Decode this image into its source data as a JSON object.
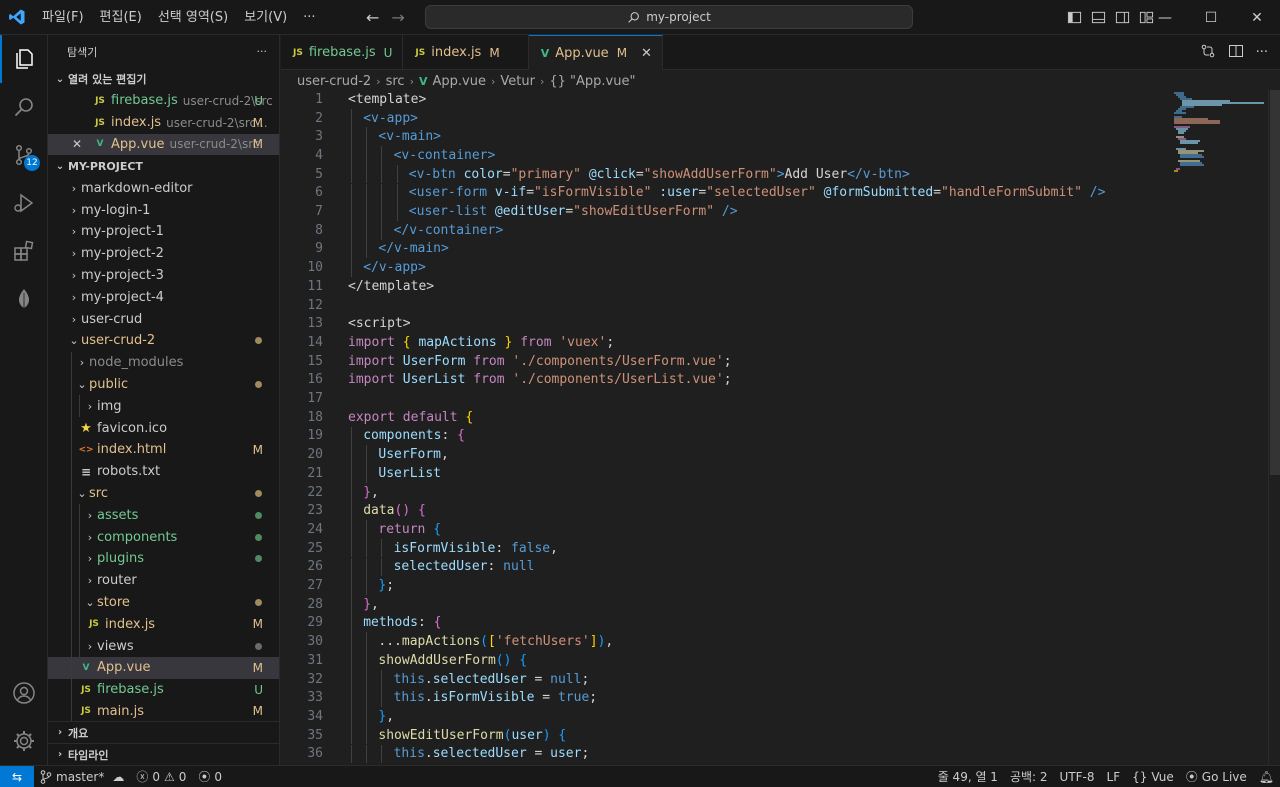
{
  "menu": [
    "파일(F)",
    "편집(E)",
    "선택 영역(S)",
    "보기(V)",
    "···"
  ],
  "search": {
    "text": "my-project"
  },
  "activity": {
    "scm_badge": "12"
  },
  "sidebar": {
    "title": "탐색기",
    "more": "···",
    "open_editors_title": "열려 있는 편집기",
    "open_editors": [
      {
        "icon": "JS",
        "name": "firebase.js",
        "path": "user-crud-2\\src",
        "badge": "U"
      },
      {
        "icon": "JS",
        "name": "index.js",
        "path": "user-crud-2\\src...",
        "badge": "M"
      },
      {
        "icon": "V",
        "name": "App.vue",
        "path": "user-crud-2\\src",
        "badge": "M"
      }
    ],
    "project_title": "MY-PROJECT",
    "tree": {
      "markdown_editor": "markdown-editor",
      "my_login_1": "my-login-1",
      "my_project_1": "my-project-1",
      "my_project_2": "my-project-2",
      "my_project_3": "my-project-3",
      "my_project_4": "my-project-4",
      "user_crud": "user-crud",
      "user_crud_2": "user-crud-2",
      "node_modules": "node_modules",
      "public": "public",
      "img": "img",
      "favicon": "favicon.ico",
      "index_html": "index.html",
      "index_html_badge": "M",
      "robots": "robots.txt",
      "src": "src",
      "assets": "assets",
      "components": "components",
      "plugins": "plugins",
      "router": "router",
      "store": "store",
      "store_index": "index.js",
      "store_index_badge": "M",
      "views": "views",
      "app_vue": "App.vue",
      "app_vue_badge": "M",
      "firebase": "firebase.js",
      "firebase_badge": "U",
      "main": "main.js",
      "main_badge": "M",
      "js_icon": "JS",
      "html_icon": "<>",
      "vue_icon": "V"
    },
    "outline_title": "개요",
    "timeline_title": "타임라인"
  },
  "tabs": [
    {
      "icon": "JS",
      "name": "firebase.js",
      "badge": "U"
    },
    {
      "icon": "JS",
      "name": "index.js",
      "badge": "M"
    },
    {
      "icon": "V",
      "name": "App.vue",
      "badge": "M",
      "close": "✕"
    }
  ],
  "breadcrumb": [
    "user-crud-2",
    "src",
    "App.vue",
    "Vetur",
    "{} \"App.vue\""
  ],
  "editor": {
    "line_numbers": [
      "1",
      "2",
      "3",
      "4",
      "5",
      "6",
      "7",
      "8",
      "9",
      "10",
      "11",
      "12",
      "13",
      "14",
      "15",
      "16",
      "17",
      "18",
      "19",
      "20",
      "21",
      "22",
      "23",
      "24",
      "25",
      "26",
      "27",
      "28",
      "29",
      "30",
      "31",
      "32",
      "33",
      "34",
      "35",
      "36"
    ]
  },
  "status": {
    "branch": "master*",
    "errors": "0",
    "warnings": "0",
    "ports": "0",
    "position": "줄 49, 열 1",
    "spaces": "공백: 2",
    "encoding": "UTF-8",
    "eol": "LF",
    "language": "Vue",
    "golive": "Go Live"
  },
  "colors": {
    "accent": "#0078d4",
    "modified": "#e2c08d",
    "untracked": "#73c991"
  }
}
